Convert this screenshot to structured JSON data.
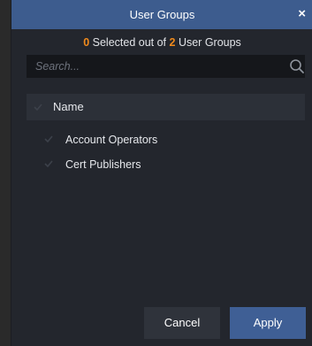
{
  "dialog": {
    "title": "User Groups",
    "close_glyph": "×"
  },
  "summary": {
    "selected_count": "0",
    "selected_text": "Selected out of",
    "total_count": "2",
    "total_text": "User Groups"
  },
  "search": {
    "placeholder": "Search...",
    "value": "",
    "icon": "search-icon"
  },
  "list": {
    "header_label": "Name",
    "items": [
      {
        "label": "Account Operators",
        "checked": false
      },
      {
        "label": "Cert Publishers",
        "checked": false
      }
    ]
  },
  "footer": {
    "cancel_label": "Cancel",
    "apply_label": "Apply"
  },
  "colors": {
    "titlebar": "#3d5c8e",
    "accent_orange": "#f08a1c",
    "apply_button": "#3f5f95",
    "background": "#23262d"
  }
}
